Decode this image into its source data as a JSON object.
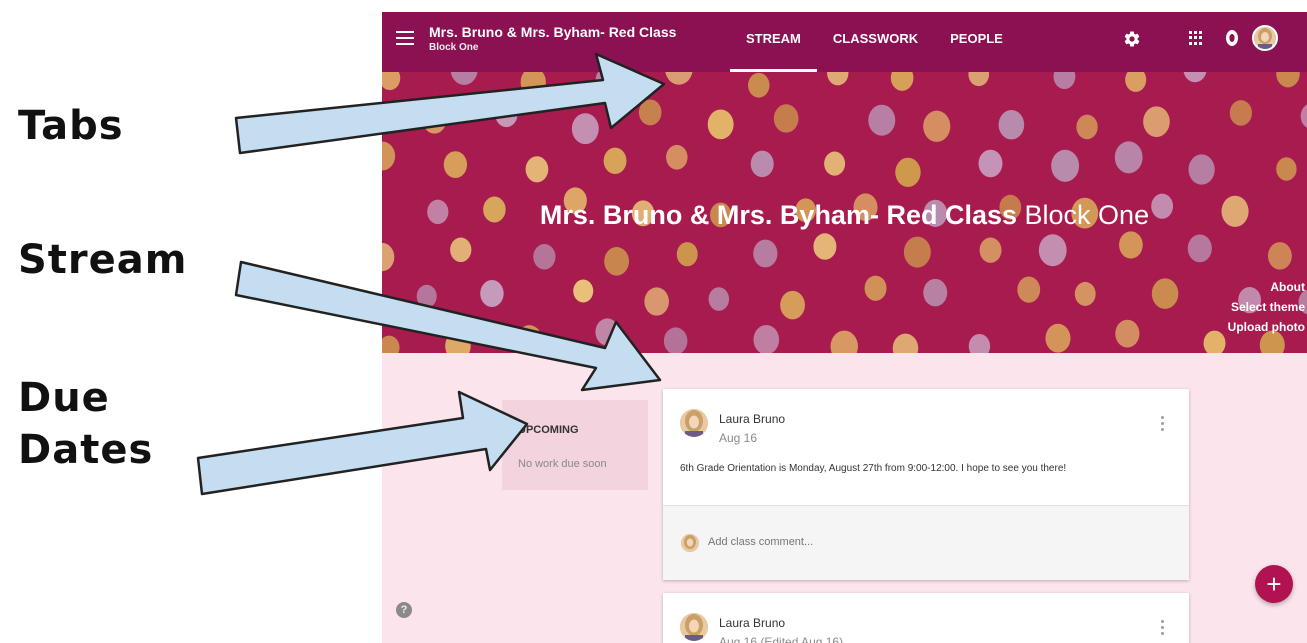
{
  "annotations": {
    "tabs_label": "Tabs",
    "stream_label": "Stream",
    "due_label_1": "Due",
    "due_label_2": "Dates",
    "arrow_fill": "#c5ddf0"
  },
  "topbar": {
    "class_name": "Mrs. Bruno & Mrs. Byham- Red Class",
    "section": "Block One",
    "tabs": [
      {
        "label": "STREAM",
        "active": true
      },
      {
        "label": "CLASSWORK",
        "active": false
      },
      {
        "label": "PEOPLE",
        "active": false
      }
    ],
    "icons": [
      "menu-icon",
      "gear-icon",
      "apps-grid-icon",
      "notification-icon",
      "avatar"
    ],
    "color": "#8b1152"
  },
  "banner": {
    "title": "Mrs. Bruno & Mrs. Byham- Red Class",
    "section": "Block One",
    "links": [
      "About",
      "Select theme",
      "Upload photo"
    ],
    "color": "#a81b4f"
  },
  "upcoming": {
    "title": "UPCOMING",
    "empty_text": "No work due soon"
  },
  "posts": [
    {
      "author": "Laura Bruno",
      "date": "Aug 16",
      "body": "6th Grade Orientation is Monday, August 27th from 9:00-12:00. I hope to see you there!",
      "comment_placeholder": "Add class comment..."
    },
    {
      "author": "Laura Bruno",
      "date": "Aug 16 (Edited Aug 16)"
    }
  ],
  "help_label": "?",
  "fab_label": "+",
  "background": "#fce4ec"
}
